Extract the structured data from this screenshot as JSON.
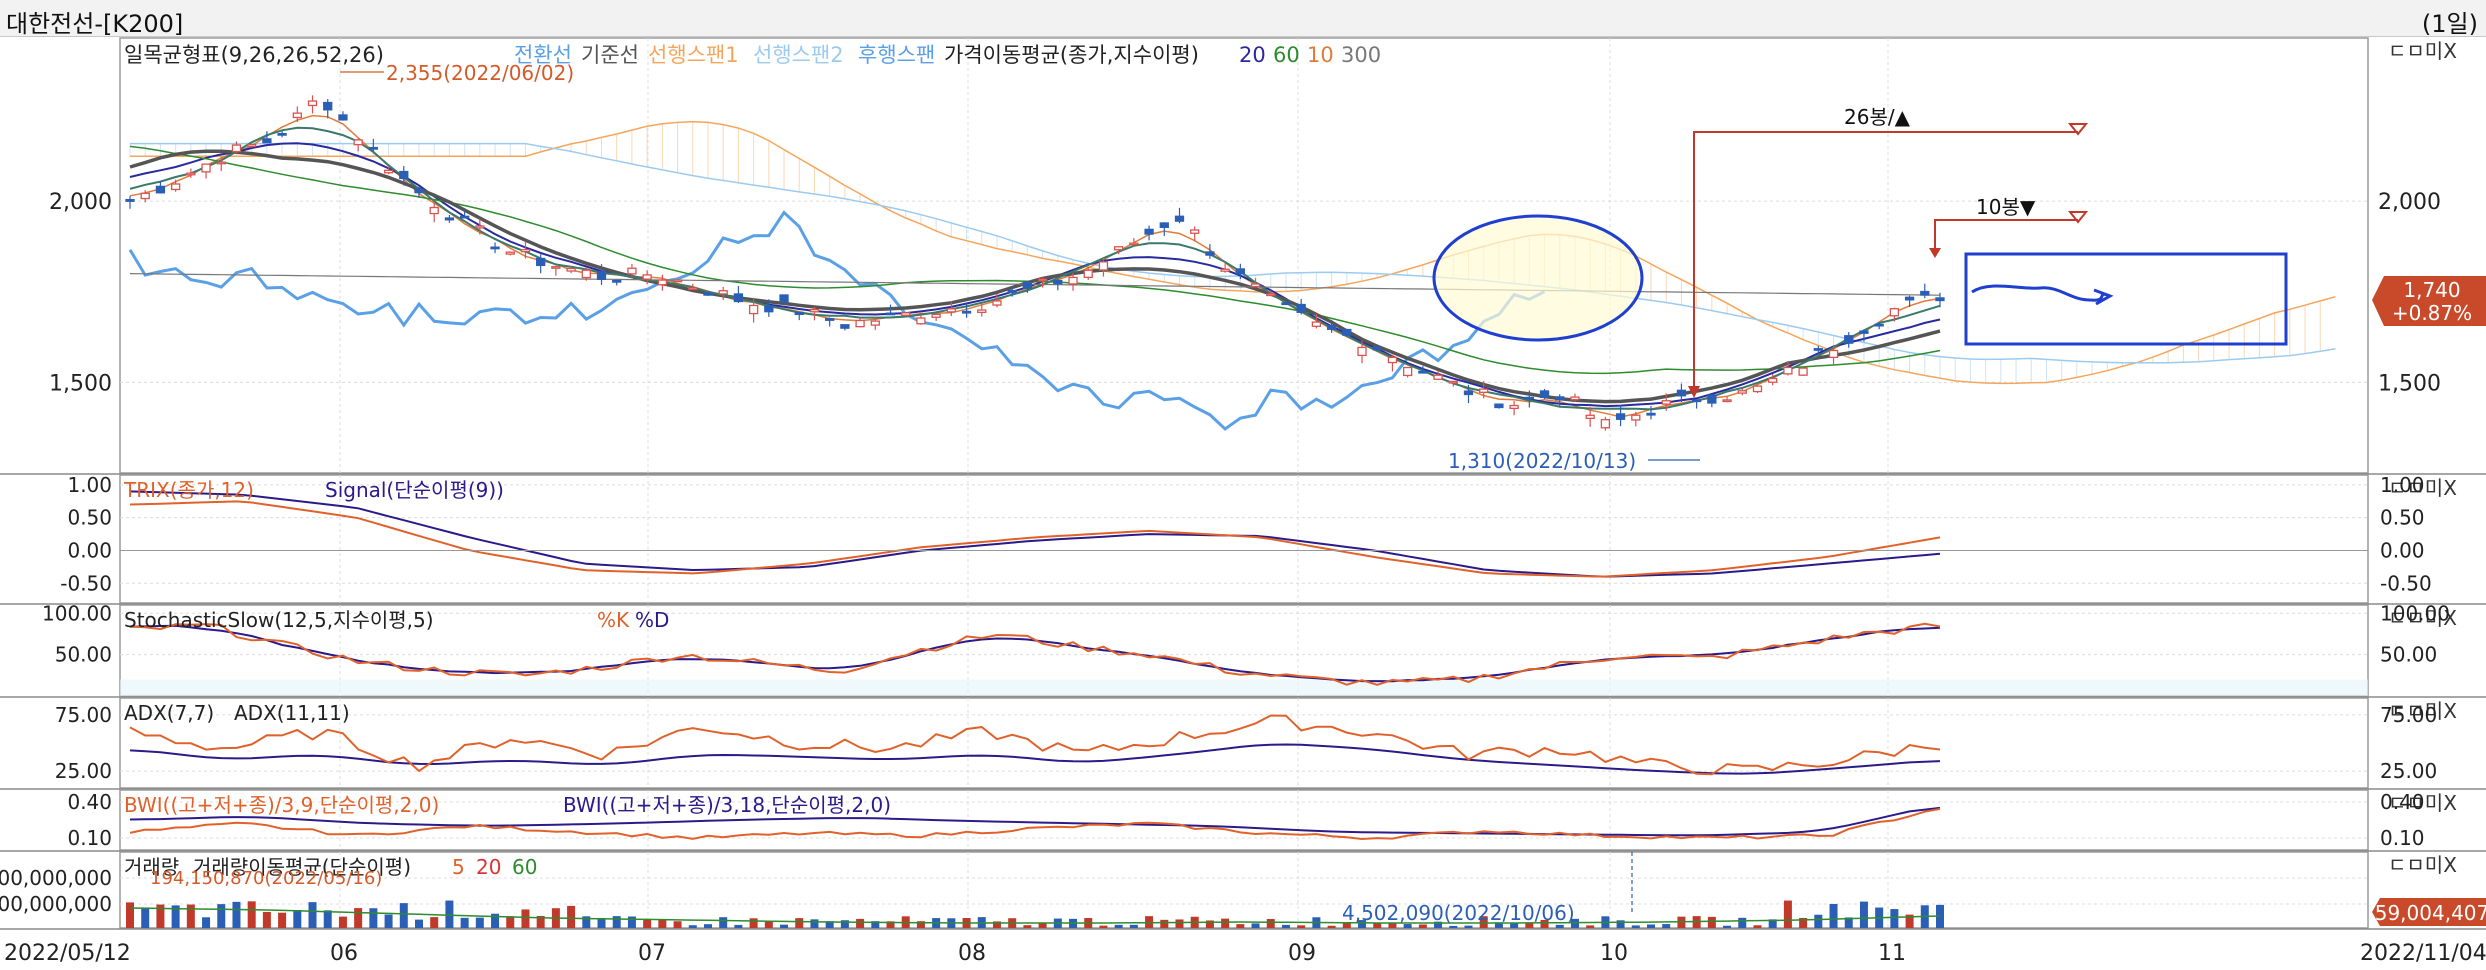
{
  "window": {
    "title": "대한전선-[K200]",
    "period": "(1일)"
  },
  "panel_buttons": "ㄷㅁ미X",
  "chart_data": [
    {
      "type": "candlestick",
      "panel": "price",
      "legend": [
        {
          "text": "일목균형표(9,26,26,52,26)",
          "color": "#222222"
        },
        {
          "text": "전환선",
          "color": "#5aa0e6"
        },
        {
          "text": "기준선",
          "color": "#555555"
        },
        {
          "text": "선행스팬1",
          "color": "#f5a65b"
        },
        {
          "text": "선행스팬2",
          "color": "#9ccbf0"
        },
        {
          "text": "후행스팬",
          "color": "#5aa0e6"
        },
        {
          "text": "가격이동평균(종가,지수이평)",
          "color": "#222222"
        },
        {
          "text": "20",
          "color": "#2a2aa0"
        },
        {
          "text": "60",
          "color": "#2e8b2e"
        },
        {
          "text": "10",
          "color": "#e07b39"
        },
        {
          "text": "300",
          "color": "#777777"
        }
      ],
      "x_ticks": [
        "2022/05/12",
        "06",
        "07",
        "08",
        "09",
        "10",
        "11",
        "2022/11/04"
      ],
      "y_ticks": [
        "2,000",
        "1,500"
      ],
      "ylim": [
        1250,
        2450
      ],
      "annotations": {
        "high": "2,355(2022/06/02)",
        "low": "1,310(2022/10/13)",
        "bars26": "26봉/▲",
        "bars10": "10봉▼"
      },
      "last_price": "1,740",
      "last_change": "+0.87%",
      "trend_values": [
        2000,
        2060,
        2130,
        2170,
        2290,
        2150,
        2030,
        1940,
        1860,
        1820,
        1790,
        1800,
        1760,
        1720,
        1700,
        1660,
        1680,
        1700,
        1720,
        1760,
        1800,
        1880,
        1960,
        1820,
        1720,
        1650,
        1610,
        1540,
        1480,
        1440,
        1470,
        1380,
        1430,
        1460,
        1470,
        1540,
        1620,
        1700,
        1740
      ]
    },
    {
      "type": "line",
      "panel": "trix",
      "legend": [
        {
          "text": "TRIX(종가,12)",
          "color": "#e0622a"
        },
        {
          "text": "Signal(단순이평(9))",
          "color": "#2a1a8a"
        }
      ],
      "y_ticks": [
        "1.00",
        "0.50",
        "0.00",
        "-0.50"
      ],
      "ylim": [
        -0.8,
        1.15
      ]
    },
    {
      "type": "line",
      "panel": "stochastic",
      "legend": [
        {
          "text": "StochasticSlow(12,5,지수이평,5)",
          "color": "#222222"
        },
        {
          "text": "%K",
          "color": "#e0622a"
        },
        {
          "text": "%D",
          "color": "#2a1a8a"
        }
      ],
      "y_ticks": [
        "100.00",
        "50.00"
      ],
      "ylim": [
        0,
        110
      ]
    },
    {
      "type": "line",
      "panel": "adx",
      "legend": [
        {
          "text": "ADX(7,7)",
          "color": "#222222"
        },
        {
          "text": "ADX(11,11)",
          "color": "#222222"
        }
      ],
      "y_ticks": [
        "75.00",
        "25.00"
      ],
      "ylim": [
        10,
        90
      ]
    },
    {
      "type": "line",
      "panel": "bwi",
      "legend": [
        {
          "text": "BWI((고+저+종)/3,9,단순이평,2,0)",
          "color": "#e0622a"
        },
        {
          "text": "BWI((고+저+종)/3,18,단순이평,2,0)",
          "color": "#2a1a8a"
        }
      ],
      "y_ticks": [
        "0.40",
        "0.10"
      ],
      "ylim": [
        0,
        0.5
      ]
    },
    {
      "type": "bar",
      "panel": "volume",
      "legend": [
        {
          "text": "거래량",
          "color": "#222222"
        },
        {
          "text": "거래량이동평균(단순이평)",
          "color": "#222222"
        },
        {
          "text": "5",
          "color": "#e0622a"
        },
        {
          "text": "20",
          "color": "#d33"
        },
        {
          "text": "60",
          "color": "#2e8b2e"
        }
      ],
      "y_ticks": [
        "00,000,000",
        "00,000,000"
      ],
      "annotations": {
        "high": "194,150,870(2022/05/16)",
        "low": "4,502,090(2022/10/06)"
      },
      "last_volume": "59,004,407"
    }
  ]
}
